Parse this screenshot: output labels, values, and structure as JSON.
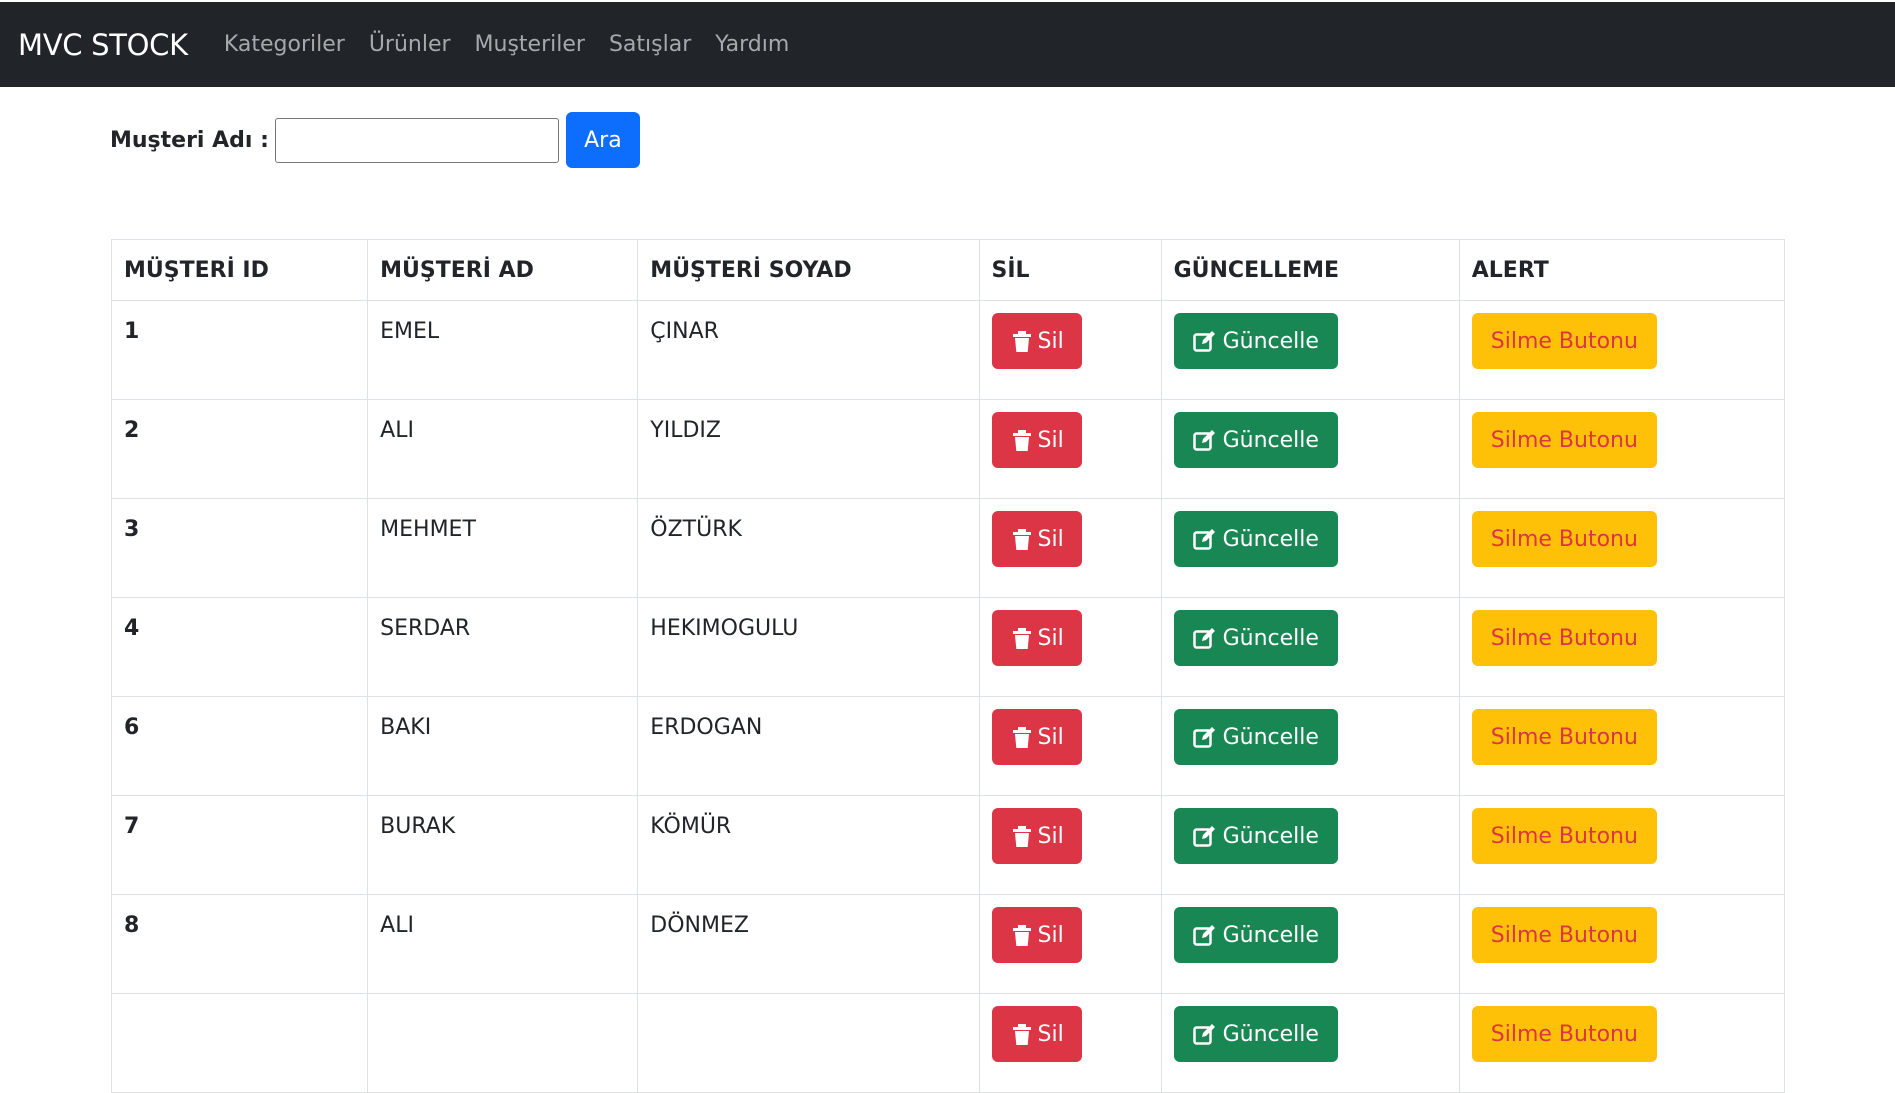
{
  "navbar": {
    "brand": "MVC STOCK",
    "links": [
      "Kategoriler",
      "Ürünler",
      "Muşteriler",
      "Satışlar",
      "Yardım"
    ]
  },
  "search": {
    "label": "Muşteri Adı :",
    "value": "",
    "button": "Ara"
  },
  "table": {
    "headers": [
      "MÜŞTERİ ID",
      "MÜŞTERİ AD",
      "MÜŞTERİ SOYAD",
      "SİL",
      "GÜNCELLEME",
      "ALERT"
    ],
    "rows": [
      {
        "id": "1",
        "ad": "EMEL",
        "soyad": "ÇINAR"
      },
      {
        "id": "2",
        "ad": "ALI",
        "soyad": "YILDIZ"
      },
      {
        "id": "3",
        "ad": "MEHMET",
        "soyad": "ÖZTÜRK"
      },
      {
        "id": "4",
        "ad": "SERDAR",
        "soyad": "HEKIMOGULU"
      },
      {
        "id": "6",
        "ad": "BAKI",
        "soyad": "ERDOGAN"
      },
      {
        "id": "7",
        "ad": "BURAK",
        "soyad": "KÖMÜR"
      },
      {
        "id": "8",
        "ad": "ALI",
        "soyad": "DÖNMEZ"
      },
      {
        "id": "",
        "ad": "",
        "soyad": ""
      }
    ],
    "delete_label": "Sil",
    "update_label": "Güncelle",
    "alert_label": "Silme Butonu"
  },
  "colors": {
    "navbar_bg": "#212529",
    "primary": "#0d6efd",
    "danger": "#dc3545",
    "success": "#198754",
    "warning": "#ffc107"
  },
  "icons": {
    "delete": "trash-icon",
    "update": "edit-icon"
  }
}
